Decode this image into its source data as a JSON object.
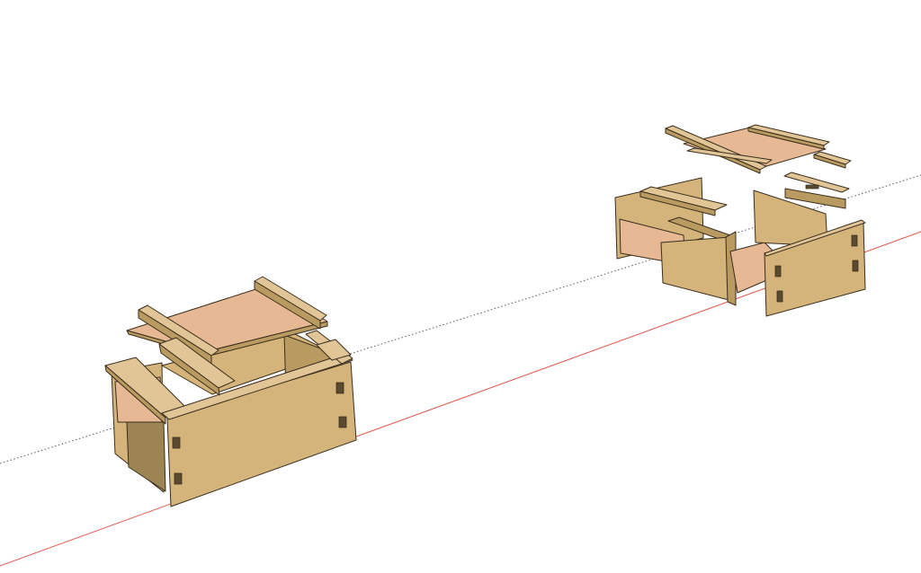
{
  "scene": {
    "background": "#ffffff",
    "axes": {
      "red_axis_color": "#e0584f",
      "dotted_axis_color": "#5a5a5a"
    },
    "palette": {
      "wood_top": "#e2c596",
      "wood_face": "#d4b47a",
      "wood_face_dark": "#b99a60",
      "wood_side": "#c6a468",
      "wood_shadow": "#9d8453",
      "wood_edge": "#3a2e1e",
      "panel_light": "#e9c7a1",
      "panel_pink": "#e6b894",
      "strip_top": "#cdb57a",
      "mortise": "#5a4a30"
    },
    "objects": [
      {
        "name": "assembled-box",
        "description_icon": "wooden-box-icon"
      },
      {
        "name": "exploded-box",
        "description_icon": "wooden-box-parts-icon"
      }
    ]
  }
}
